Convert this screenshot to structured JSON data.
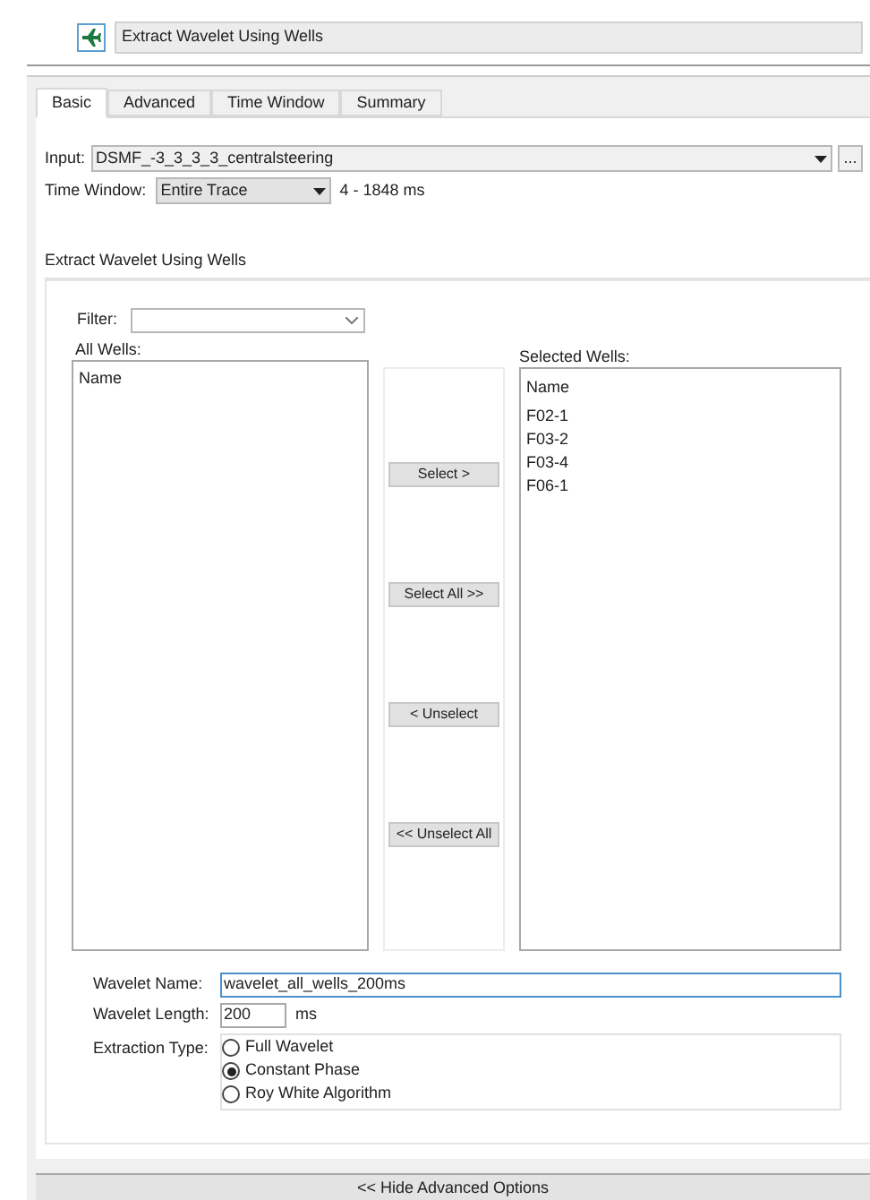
{
  "window": {
    "title": "Extract Wavelet Using Wells"
  },
  "tabs": [
    {
      "label": "Basic",
      "selected": true
    },
    {
      "label": "Advanced",
      "selected": false
    },
    {
      "label": "Time Window",
      "selected": false
    },
    {
      "label": "Summary",
      "selected": false
    }
  ],
  "input": {
    "label": "Input:",
    "value": "DSMF_-3_3_3_3_centralsteering",
    "browse": "..."
  },
  "time_window": {
    "label": "Time Window:",
    "value": "Entire Trace",
    "range": "4 - 1848 ms"
  },
  "group": {
    "title": "Extract Wavelet Using Wells",
    "filter": {
      "label": "Filter:"
    },
    "all_wells": {
      "label": "All Wells:",
      "column": "Name"
    },
    "buttons": [
      "Select >",
      "Select All >>",
      "< Unselect",
      "<< Unselect All"
    ],
    "selected_wells": {
      "label": "Selected Wells:",
      "column": "Name",
      "rows": [
        "F02-1",
        "F03-2",
        "F03-4",
        "F06-1"
      ]
    }
  },
  "wavelet_name": {
    "label": "Wavelet Name:",
    "value": "wavelet_all_wells_200ms"
  },
  "wavelet_length": {
    "label": "Wavelet Length:",
    "value": "200",
    "unit": "ms"
  },
  "extraction_type": {
    "label": "Extraction Type:",
    "options": [
      {
        "label": "Full Wavelet",
        "selected": false
      },
      {
        "label": "Constant Phase",
        "selected": true
      },
      {
        "label": "Roy White Algorithm",
        "selected": false
      }
    ]
  },
  "footer": {
    "label": "<< Hide Advanced Options"
  }
}
